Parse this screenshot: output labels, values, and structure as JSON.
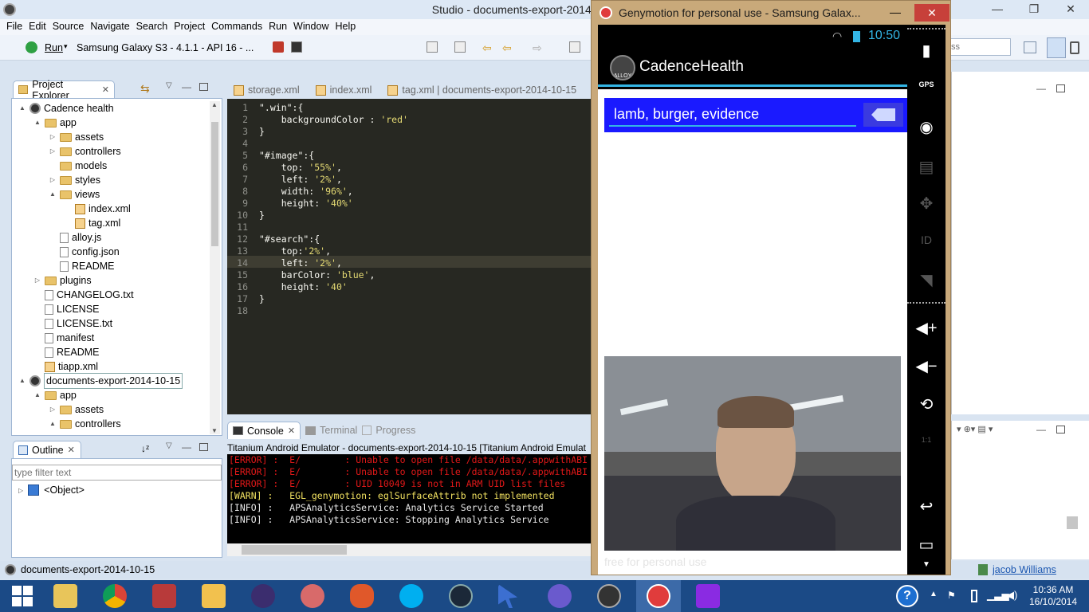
{
  "window": {
    "title": "Studio - documents-export-2014-10-15/app/st",
    "min": "—",
    "max": "❐",
    "close": "✕"
  },
  "menu": [
    "File",
    "Edit",
    "Source",
    "Navigate",
    "Search",
    "Project",
    "Commands",
    "Run",
    "Window",
    "Help"
  ],
  "toolbar": {
    "run_label": "Run",
    "device": "Samsung Galaxy S3 - 4.1.1 - API 16 - ...",
    "search_placeholder": "ss"
  },
  "project_explorer": {
    "tab_label": "Project Explorer",
    "tree": [
      {
        "label": "Cadence health",
        "indent": 0,
        "type": "proj",
        "twist": "▲"
      },
      {
        "label": "app",
        "indent": 1,
        "type": "folder",
        "twist": "▲"
      },
      {
        "label": "assets",
        "indent": 2,
        "type": "folder",
        "twist": "▷"
      },
      {
        "label": "controllers",
        "indent": 2,
        "type": "folder",
        "twist": "▷"
      },
      {
        "label": "models",
        "indent": 2,
        "type": "folder",
        "twist": ""
      },
      {
        "label": "styles",
        "indent": 2,
        "type": "folder",
        "twist": "▷"
      },
      {
        "label": "views",
        "indent": 2,
        "type": "folder",
        "twist": "▲"
      },
      {
        "label": "index.xml",
        "indent": 3,
        "type": "xml",
        "twist": ""
      },
      {
        "label": "tag.xml",
        "indent": 3,
        "type": "xml",
        "twist": ""
      },
      {
        "label": "alloy.js",
        "indent": 2,
        "type": "file",
        "twist": ""
      },
      {
        "label": "config.json",
        "indent": 2,
        "type": "file",
        "twist": ""
      },
      {
        "label": "README",
        "indent": 2,
        "type": "file",
        "twist": ""
      },
      {
        "label": "plugins",
        "indent": 1,
        "type": "folder",
        "twist": "▷"
      },
      {
        "label": "CHANGELOG.txt",
        "indent": 1,
        "type": "file",
        "twist": ""
      },
      {
        "label": "LICENSE",
        "indent": 1,
        "type": "file",
        "twist": ""
      },
      {
        "label": "LICENSE.txt",
        "indent": 1,
        "type": "file",
        "twist": ""
      },
      {
        "label": "manifest",
        "indent": 1,
        "type": "file",
        "twist": ""
      },
      {
        "label": "README",
        "indent": 1,
        "type": "file",
        "twist": ""
      },
      {
        "label": "tiapp.xml",
        "indent": 1,
        "type": "xml",
        "twist": ""
      },
      {
        "label": "documents-export-2014-10-15",
        "indent": 0,
        "type": "proj",
        "twist": "▲"
      },
      {
        "label": "app",
        "indent": 1,
        "type": "folder",
        "twist": "▲"
      },
      {
        "label": "assets",
        "indent": 2,
        "type": "folder",
        "twist": "▷"
      },
      {
        "label": "controllers",
        "indent": 2,
        "type": "folder",
        "twist": "▲"
      }
    ]
  },
  "outline": {
    "tab_label": "Outline",
    "filter_placeholder": "type filter text",
    "item": "<Object>"
  },
  "editor_tabs": [
    "storage.xml",
    "index.xml",
    "tag.xml | documents-export-2014-10-15"
  ],
  "code": [
    "\".win\":{",
    "    backgroundColor : 'red'",
    "}",
    "",
    "\"#image\":{",
    "    top: '55%',",
    "    left: '2%',",
    "    width: '96%',",
    "    height: '40%'",
    "}",
    "",
    "\"#search\":{",
    "    top:'2%',",
    "    left: '2%',",
    "    barColor: 'blue',",
    "    height: '40'",
    "}",
    ""
  ],
  "console_tabs": [
    "Console",
    "Terminal",
    "Progress"
  ],
  "console_header": "Titanium Android Emulator - documents-export-2014-10-15 [Titanium Android Emulat",
  "console_lines": [
    {
      "level": "err",
      "text": "[ERROR] :  E/        : Unable to open file /data/data/.appwithABI"
    },
    {
      "level": "err",
      "text": "[ERROR] :  E/        : Unable to open file /data/data/.appwithABI"
    },
    {
      "level": "err",
      "text": "[ERROR] :  E/        : UID 10049 is not in ARM UID list files"
    },
    {
      "level": "warn",
      "text": "[WARN] :   EGL_genymotion: eglSurfaceAttrib not implemented"
    },
    {
      "level": "info",
      "text": "[INFO] :   APSAnalyticsService: Analytics Service Started"
    },
    {
      "level": "info",
      "text": "[INFO] :   APSAnalyticsService: Stopping Analytics Service"
    }
  ],
  "status_bar": {
    "project": "documents-export-2014-10-15",
    "user": "jacob Williams"
  },
  "genymotion": {
    "title": "Genymotion for personal use - Samsung Galax...",
    "clock": "10:50",
    "app_title": "CadenceHealth",
    "logo_text": "ALLOY",
    "search_value": "lamb, burger, evidence",
    "watermark": "free for personal use",
    "side_labels": {
      "gps": "GPS",
      "id": "ID",
      "ratio": "1:1"
    }
  },
  "taskbar": {
    "time": "10:36 AM",
    "date": "16/10/2014"
  }
}
